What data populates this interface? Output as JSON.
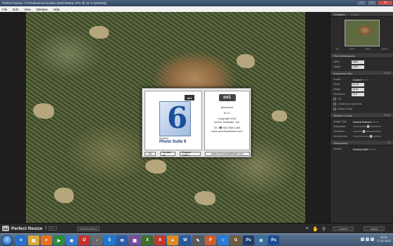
{
  "window": {
    "title": "Perfect Resize 7.0 Professional Edition [DSC00846.JPG @ 32 % (RGB/8)]",
    "minimize_glyph": "–",
    "maximize_glyph": "□",
    "close_glyph": "✕"
  },
  "menu": [
    "File",
    "Edit",
    "View",
    "Window",
    "Help"
  ],
  "about_dialog": {
    "box_brand": "on1",
    "box_word": "Perfect",
    "box_title": "Photo Suite 6",
    "six": "6",
    "logo": "on1",
    "user": "pinewood",
    "version": "6.0.1",
    "copyright": "Copyright 2011",
    "company": "onOne Software, Inc.",
    "tel": "Tel. ☎ 503.968.1468",
    "web": "www.ononesoftware.com",
    "buttons": [
      "OK",
      "Contact Us",
      "Register Online...",
      "www.on1ononesoftware.com"
    ]
  },
  "panel": {
    "navigator": {
      "title": "Navigator",
      "tab": "Loupe",
      "zoom_labels": [
        "Fit",
        "25%",
        "50%",
        "100%"
      ]
    },
    "pixel_dimensions": {
      "title": "Pixel Dimensions",
      "width_label": "Width",
      "width_value": "1600",
      "height_label": "Height",
      "height_value": "1200"
    },
    "document_size": {
      "title": "Document Size",
      "reset": "Reset",
      "preset_label": "Preset",
      "preset_value": "Custom",
      "width_label": "Width",
      "width_value": "22.22",
      "height_label": "Height",
      "height_value": "16.67",
      "resolution_label": "Resolution",
      "resolution_value": "72.0",
      "options": [
        "Tile",
        "Constrain proportions",
        "Gallery Wrap"
      ]
    },
    "texture_control": {
      "title": "Texture Control",
      "reset": "Reset",
      "image_type_label": "Image Type",
      "image_type_value": "General Purpose",
      "sliders": [
        "Sharpness",
        "Threshold",
        "Smoothness"
      ]
    },
    "sharpening": {
      "title": "Sharpening",
      "reset": "Reset",
      "off": "Off",
      "method_label": "Method",
      "method_value": "Unsharp Mask"
    }
  },
  "bottom": {
    "brand_logo": "on1",
    "app_name": "Perfect Resize",
    "version": "7",
    "edition": "Pro",
    "fix_button": "Fix/Hide Before",
    "cancel": "Cancel",
    "apply": "Apply",
    "tools": [
      "crop-tool-icon",
      "hand-tool-icon",
      "zoom-tool-icon"
    ]
  },
  "taskbar": {
    "apps": [
      "ie-icon",
      "explorer-icon",
      "media-player-icon",
      "firefox-icon",
      "chrome-icon",
      "opera-icon",
      "itunes-icon",
      "skype-icon",
      "outlook-icon",
      "photoshop-icon",
      "vlc-icon",
      "acrobat-icon",
      "calendar-icon",
      "paint-icon",
      "word-icon",
      "excel-icon",
      "powerpoint-icon",
      "msn-icon",
      "gimp-icon",
      "notepad-icon",
      "ps-icon"
    ],
    "time": "16:31",
    "date": "17.01.2012"
  }
}
